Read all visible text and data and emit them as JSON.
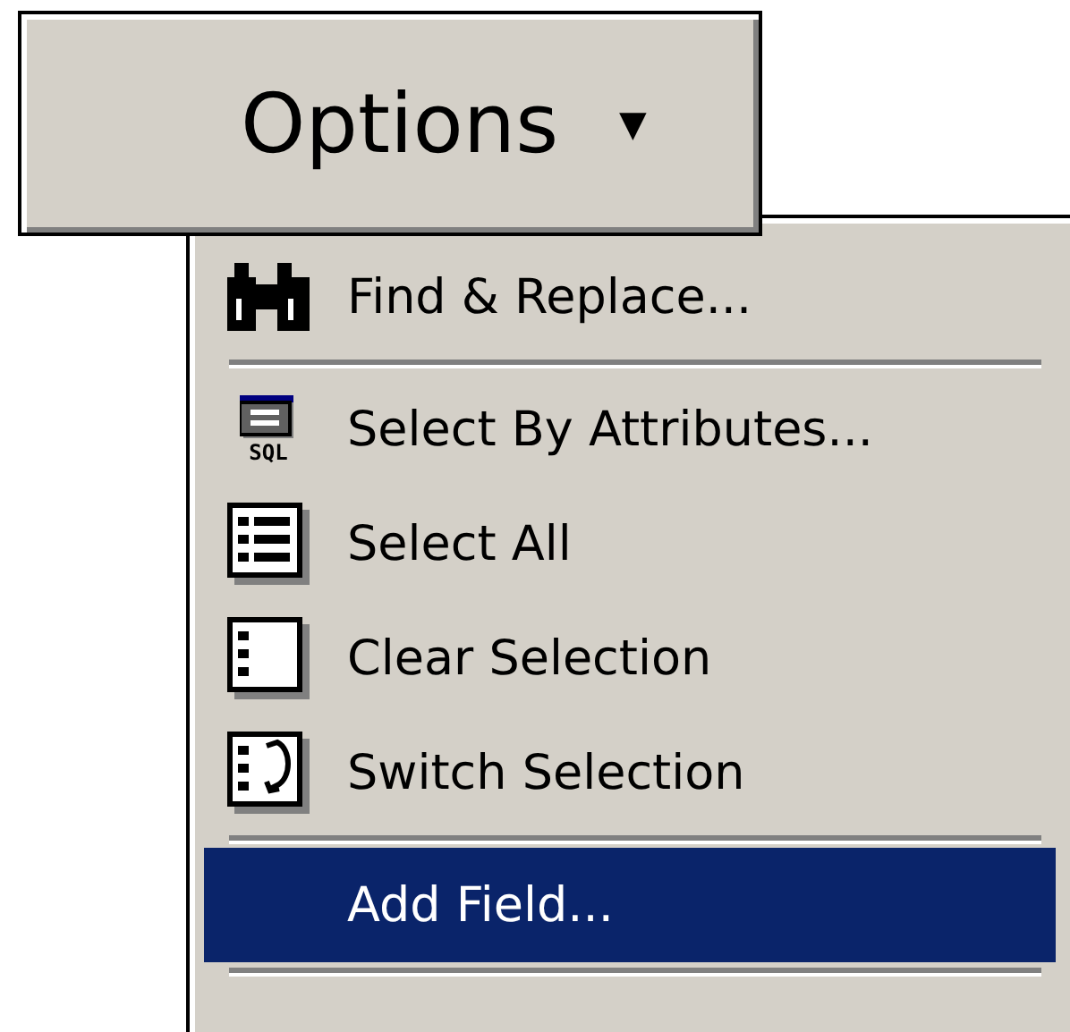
{
  "button": {
    "label": "Options",
    "caret": "▼"
  },
  "menu": {
    "items": [
      {
        "kind": "command",
        "label": "Find & Replace...",
        "selected": false
      },
      {
        "kind": "separator"
      },
      {
        "kind": "command",
        "label": "Select By Attributes...",
        "icon_label": "SQL",
        "selected": false
      },
      {
        "kind": "command",
        "label": "Select All",
        "selected": false
      },
      {
        "kind": "command",
        "label": "Clear Selection",
        "selected": false
      },
      {
        "kind": "command",
        "label": "Switch Selection",
        "selected": false
      },
      {
        "kind": "separator"
      },
      {
        "kind": "command",
        "label": "Add Field...",
        "selected": true
      },
      {
        "kind": "separator"
      }
    ]
  }
}
